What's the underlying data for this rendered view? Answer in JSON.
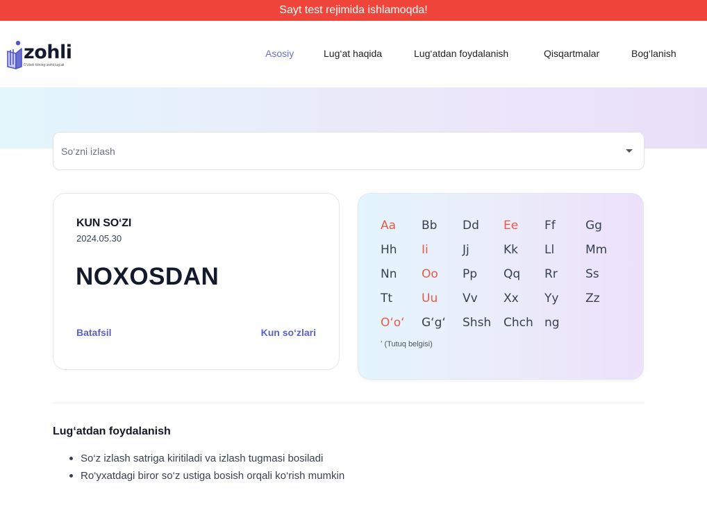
{
  "banner": {
    "text": "Sayt test rejimida ishlamoqda!"
  },
  "logo": {
    "name": "zohli",
    "tagline": "O‘zbek tilining izohli lug‘ati"
  },
  "nav": [
    {
      "label": "Asosiy",
      "active": true
    },
    {
      "label": "Lug‘at haqida",
      "active": false
    },
    {
      "label": "Lug‘atdan foydalanish",
      "active": false
    },
    {
      "label": "Qisqartmalar",
      "active": false
    },
    {
      "label": "Bog‘lanish",
      "active": false
    }
  ],
  "search": {
    "placeholder": "So‘zni izlash",
    "value": ""
  },
  "word_of_day": {
    "heading": "KUN SO‘ZI",
    "date": "2024.05.30",
    "word": "NOXOSDAN",
    "details_link": "Batafsil",
    "all_words_link": "Kun so‘zlari"
  },
  "alphabet": {
    "letters": [
      {
        "label": "Aa",
        "vowel": true
      },
      {
        "label": "Bb",
        "vowel": false
      },
      {
        "label": "Dd",
        "vowel": false
      },
      {
        "label": "Ee",
        "vowel": true
      },
      {
        "label": "Ff",
        "vowel": false
      },
      {
        "label": "Gg",
        "vowel": false
      },
      {
        "label": "Hh",
        "vowel": false
      },
      {
        "label": "Ii",
        "vowel": true
      },
      {
        "label": "Jj",
        "vowel": false
      },
      {
        "label": "Kk",
        "vowel": false
      },
      {
        "label": "Ll",
        "vowel": false
      },
      {
        "label": "Mm",
        "vowel": false
      },
      {
        "label": "Nn",
        "vowel": false
      },
      {
        "label": "Oo",
        "vowel": true
      },
      {
        "label": "Pp",
        "vowel": false
      },
      {
        "label": "Qq",
        "vowel": false
      },
      {
        "label": "Rr",
        "vowel": false
      },
      {
        "label": "Ss",
        "vowel": false
      },
      {
        "label": "Tt",
        "vowel": false
      },
      {
        "label": "Uu",
        "vowel": true
      },
      {
        "label": "Vv",
        "vowel": false
      },
      {
        "label": "Xx",
        "vowel": false
      },
      {
        "label": "Yy",
        "vowel": false
      },
      {
        "label": "Zz",
        "vowel": false
      },
      {
        "label": "O‘o‘",
        "vowel": true
      },
      {
        "label": "G‘g‘",
        "vowel": false
      },
      {
        "label": "Shsh",
        "vowel": false
      },
      {
        "label": "Chch",
        "vowel": false
      },
      {
        "label": "ng",
        "vowel": false
      }
    ],
    "apostrophe_note": "ʼ (Tutuq belgisi)"
  },
  "usage": {
    "title": "Lug‘atdan foydalanish",
    "items": [
      "So‘z izlash satriga kiritiladi va izlash tugmasi bosiladi",
      "Ro‘yxatdagi biror so‘z ustiga bosish orqali ko‘rish mumkin"
    ]
  },
  "colors": {
    "banner": "#f0453a",
    "accent": "#6a6fd1",
    "vowel": "#e55a48",
    "link": "#5a62c6"
  }
}
